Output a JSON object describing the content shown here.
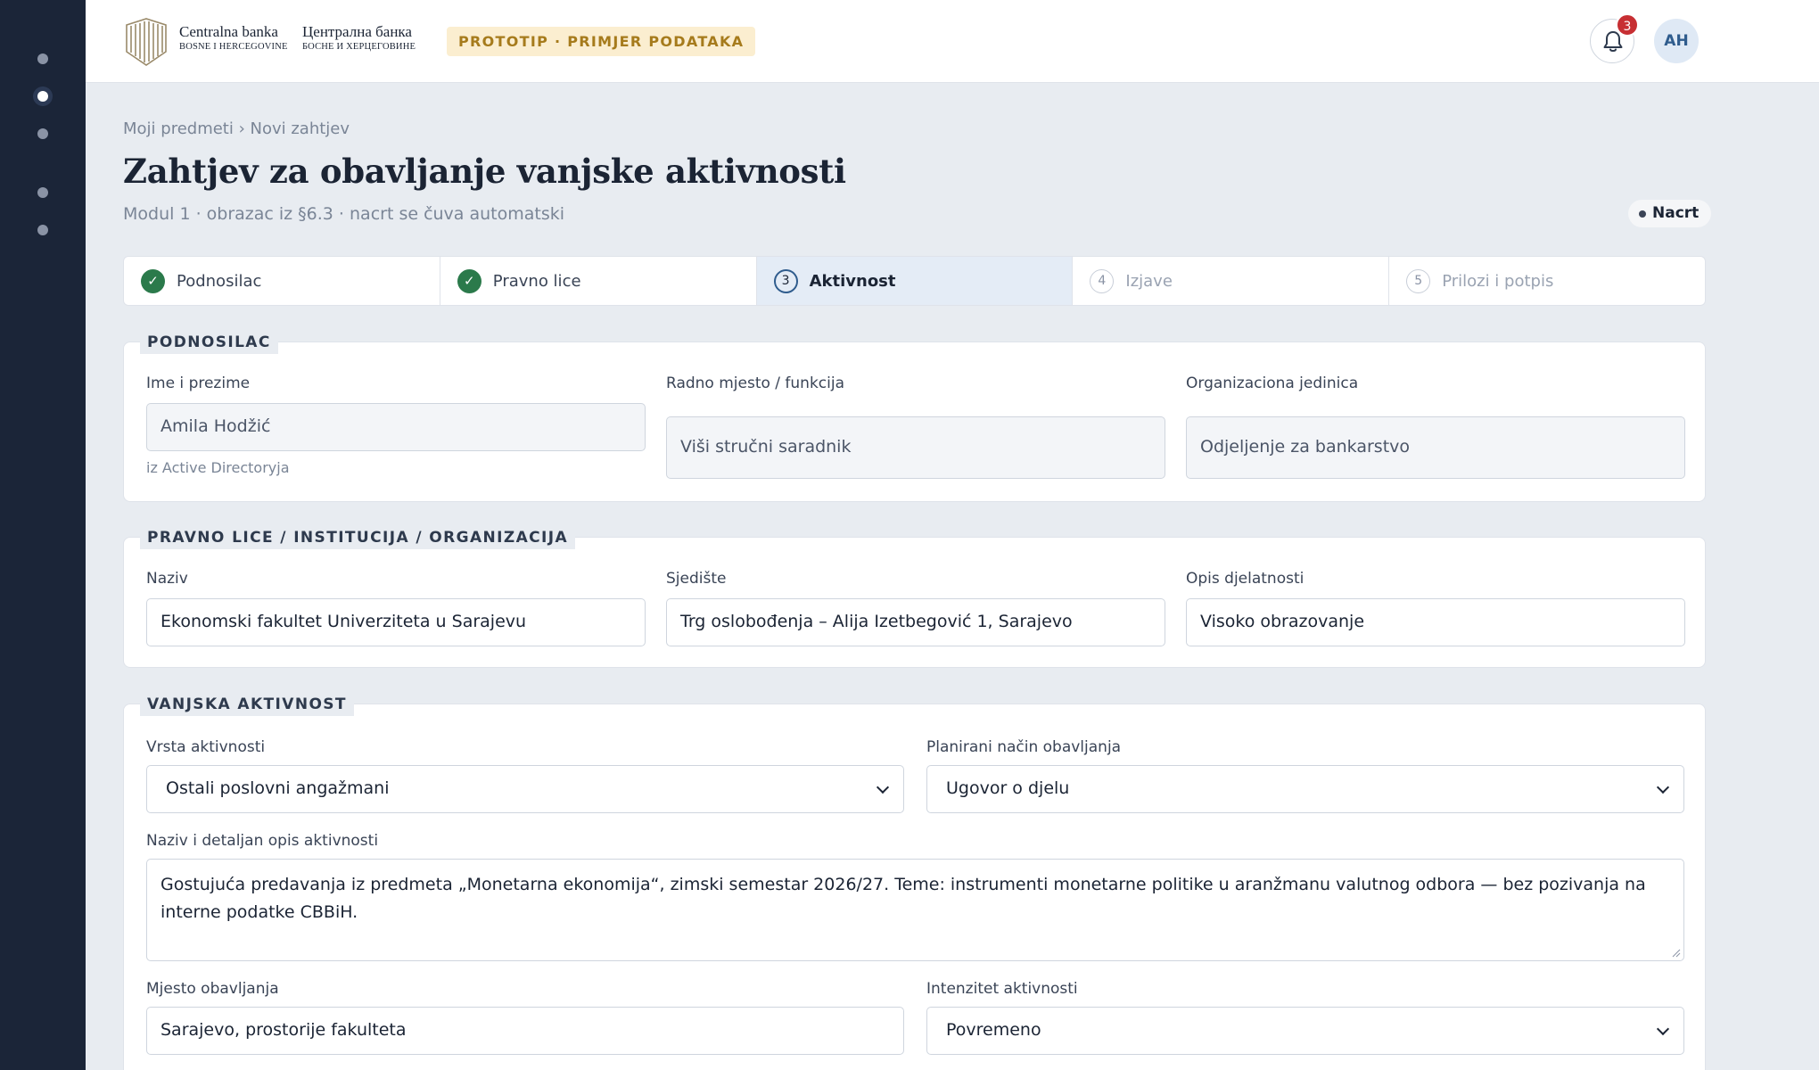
{
  "brand": {
    "latin_name": "Centralna banka",
    "latin_sub": "BOSNE I HERCEGOVINE",
    "cyr_name": "Централна банка",
    "cyr_sub": "БОСНЕ И ХЕРЦЕГОВИНЕ",
    "prototype_tag": "PROTOTIP · PRIMJER PODATAKA"
  },
  "topbar": {
    "notification_count": "3",
    "avatar_initials": "AH"
  },
  "breadcrumb": "Moji predmeti › Novi zahtjev",
  "page": {
    "title": "Zahtjev za obavljanje vanjske aktivnosti",
    "subtitle": "Modul 1 · obrazac iz §6.3 · nacrt se čuva automatski",
    "status": "Nacrt"
  },
  "steps": [
    {
      "marker": "✓",
      "label": "Podnosilac",
      "state": "done"
    },
    {
      "marker": "✓",
      "label": "Pravno lice",
      "state": "done"
    },
    {
      "marker": "3",
      "label": "Aktivnost",
      "state": "current"
    },
    {
      "marker": "4",
      "label": "Izjave",
      "state": "todo"
    },
    {
      "marker": "5",
      "label": "Prilozi i potpis",
      "state": "todo"
    }
  ],
  "applicant": {
    "legend": "PODNOSILAC",
    "name_label": "Ime i prezime",
    "name_value": "Amila Hodžić",
    "name_hint": "iz Active Directoryja",
    "position_label": "Radno mjesto / funkcija",
    "position_value": "Viši stručni saradnik",
    "unit_label": "Organizaciona jedinica",
    "unit_value": "Odjeljenje za bankarstvo"
  },
  "entity": {
    "legend": "PRAVNO LICE / INSTITUCIJA / ORGANIZACIJA",
    "name_label": "Naziv",
    "name_value": "Ekonomski fakultet Univerziteta u Sarajevu",
    "seat_label": "Sjedište",
    "seat_value": "Trg oslobođenja – Alija Izetbegović 1, Sarajevo",
    "activity_label": "Opis djelatnosti",
    "activity_value": "Visoko obrazovanje"
  },
  "activity": {
    "legend": "VANJSKA AKTIVNOST",
    "type_label": "Vrsta aktivnosti",
    "type_value": "Ostali poslovni angažmani",
    "mode_label": "Planirani način obavljanja",
    "mode_value": "Ugovor o djelu",
    "desc_label": "Naziv i detaljan opis aktivnosti",
    "desc_value": "Gostujuća predavanja iz predmeta „Monetarna ekonomija“, zimski semestar 2026/27. Teme: instrumenti monetarne politike u aranžmanu valutnog odbora — bez pozivanja na interne podatke CBBiH.",
    "place_label": "Mjesto obavljanja",
    "place_value": "Sarajevo, prostorije fakulteta",
    "intensity_label": "Intenzitet aktivnosti",
    "intensity_value": "Povremeno"
  },
  "colors": {
    "rail": "#1b2538",
    "accent": "#2f5c8d",
    "done": "#2b7a4b",
    "badge": "#c72f33",
    "prototype_bg": "#fbeed0",
    "prototype_text": "#a67b1c"
  }
}
